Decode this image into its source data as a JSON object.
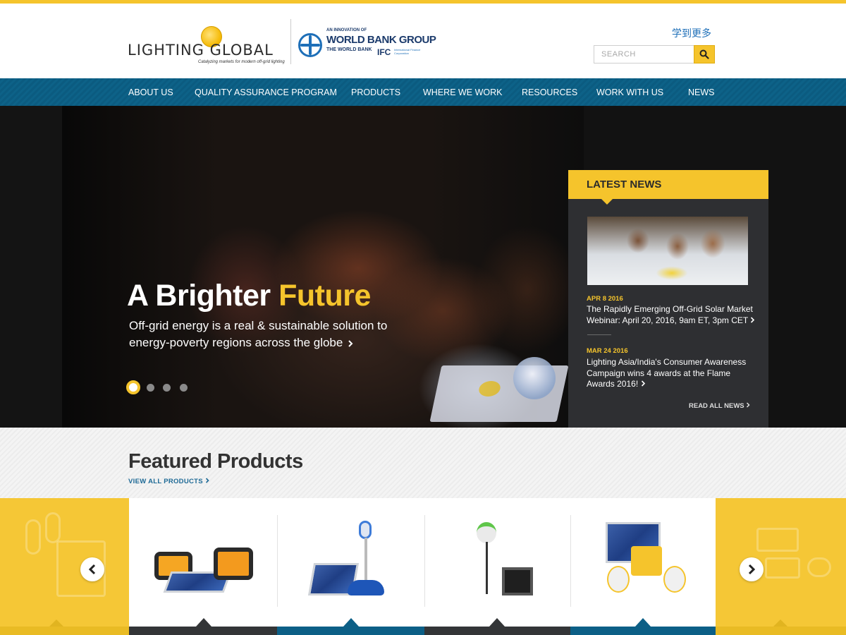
{
  "header": {
    "logo_primary": "LIGHTING GLOBAL",
    "logo_tagline": "Catalyzing markets for modern off-grid lighting",
    "partner_innovation": "AN INNOVATION OF",
    "partner_name": "WORLD BANK GROUP",
    "partner_wb": "THE WORLD BANK",
    "partner_ifc": "IFC",
    "partner_ifc_sub": "International Finance Corporation",
    "language_link": "学到更多",
    "search_placeholder": "SEARCH"
  },
  "nav": {
    "items": [
      {
        "label": "ABOUT US"
      },
      {
        "label": "QUALITY ASSURANCE PROGRAM"
      },
      {
        "label": "PRODUCTS"
      },
      {
        "label": "WHERE WE WORK"
      },
      {
        "label": "RESOURCES"
      },
      {
        "label": "WORK WITH US"
      },
      {
        "label": "NEWS"
      }
    ]
  },
  "hero": {
    "title_plain": "A Brighter",
    "title_accent": "Future",
    "subtitle": "Off-grid energy is a real & sustainable solution to energy-poverty regions across the globe",
    "slide_count": 4,
    "active_slide": 1
  },
  "news": {
    "heading": "LATEST NEWS",
    "items": [
      {
        "date": "APR 8 2016",
        "text": "The Rapidly Emerging Off-Grid Solar Market Webinar: April 20, 2016, 9am ET, 3pm CET"
      },
      {
        "date": "MAR 24 2016",
        "text": "Lighting Asia/India's Consumer Awareness Campaign wins 4 awards at the Flame Awards 2016!"
      }
    ],
    "read_all": "READ ALL NEWS"
  },
  "featured": {
    "title": "Featured Products",
    "view_all": "VIEW ALL PRODUCTS"
  },
  "colors": {
    "accent_yellow": "#f5c42c",
    "nav_blue": "#0b5b80",
    "news_panel": "#2e2f32",
    "link_blue": "#1e6a96"
  },
  "icons": {
    "search": "search-icon",
    "chevron_right": "chevron-right-icon",
    "carousel_prev": "chevron-left-icon",
    "carousel_next": "chevron-right-icon"
  }
}
